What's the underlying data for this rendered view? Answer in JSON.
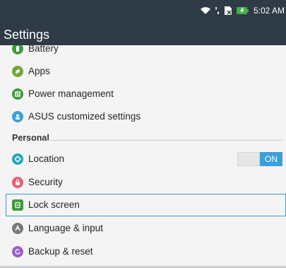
{
  "status": {
    "time": "5:02 AM",
    "icons": [
      "wifi-icon",
      "data-arrows-icon",
      "no-sim-icon",
      "battery-charging-icon"
    ]
  },
  "header": {
    "title": "Settings"
  },
  "settings": {
    "items_top": [
      {
        "label": "Battery",
        "icon": "battery-icon",
        "color": "#3f9a3a"
      },
      {
        "label": "Apps",
        "icon": "apps-icon",
        "color": "#6fa83a"
      },
      {
        "label": "Power management",
        "icon": "power-icon",
        "color": "#3f9a3a"
      },
      {
        "label": "ASUS customized settings",
        "icon": "asus-settings-icon",
        "color": "#3aa0dc"
      }
    ],
    "personal_header": "Personal",
    "items_personal": [
      {
        "label": "Location",
        "icon": "location-icon",
        "color": "#22a6b8"
      },
      {
        "label": "Security",
        "icon": "lock-icon",
        "color": "#e85b6f"
      },
      {
        "label": "Lock screen",
        "icon": "lock-screen-icon",
        "color": "#3f9a3a"
      },
      {
        "label": "Language & input",
        "icon": "language-icon",
        "color": "#7a7a7a"
      },
      {
        "label": "Backup & reset",
        "icon": "backup-icon",
        "color": "#9b5fc7"
      }
    ],
    "location_toggle": {
      "state_label": "ON",
      "on_color": "#3aa0dc"
    }
  }
}
